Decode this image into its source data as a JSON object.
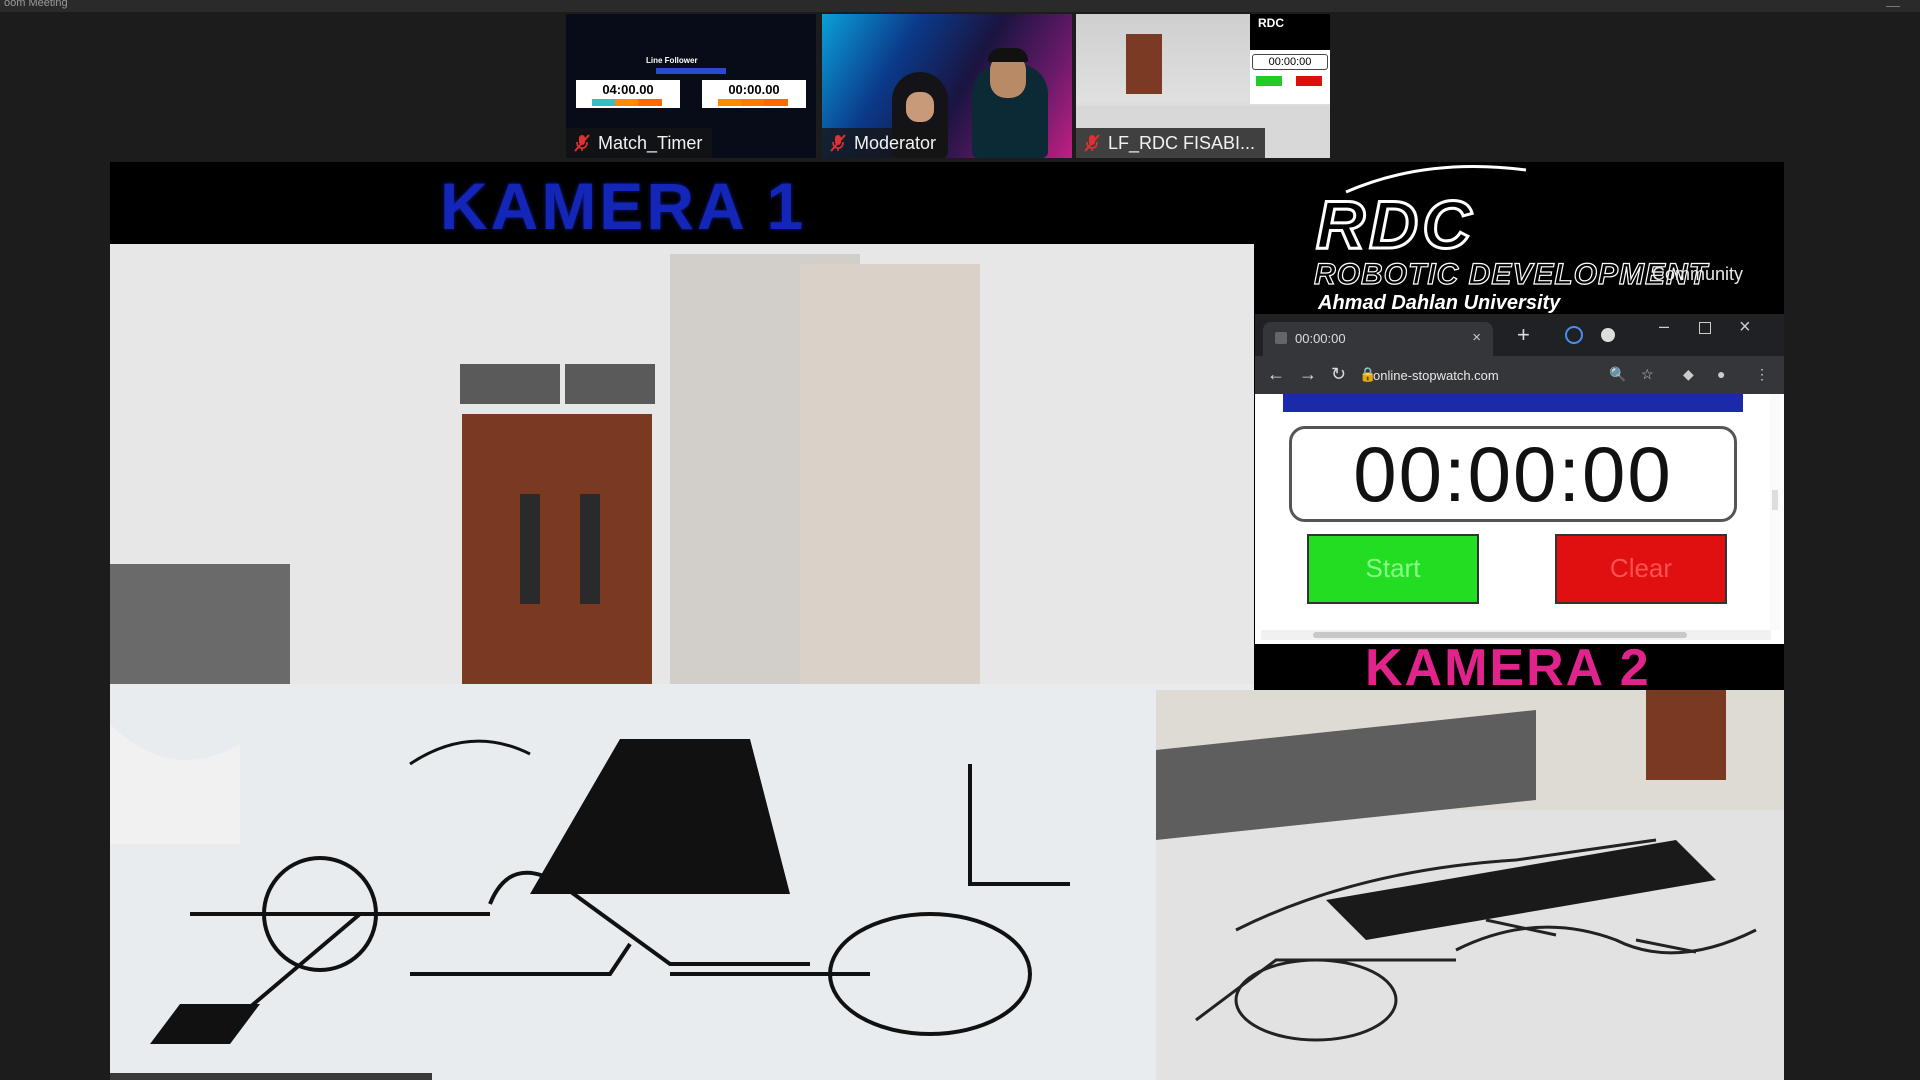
{
  "window": {
    "title": "oom Meeting"
  },
  "participants": [
    {
      "name": "Match_Timer",
      "muted": true
    },
    {
      "name": "Moderator",
      "muted": true
    },
    {
      "name": "LF_RDC FISABI...",
      "muted": true,
      "active_speaker": true
    }
  ],
  "match_timer_thumb": {
    "heading": "Line Follower",
    "timer_left": "04:00.00",
    "timer_right": "00:00.00"
  },
  "rdc_thumb": {
    "logo": "RDC",
    "timer": "00:00:00"
  },
  "stage": {
    "camera1_label": "KAMERA 1",
    "camera2_label": "KAMERA 2"
  },
  "logo": {
    "abbr": "RDC",
    "line1": "ROBOTIC DEVELOPMENT",
    "line1_suffix": "Community",
    "line2": "Ahmad Dahlan University"
  },
  "browser": {
    "tab_title": "00:00:00",
    "url": "online-stopwatch.com",
    "stopwatch": {
      "display": "00:00:00",
      "start_label": "Start",
      "clear_label": "Clear"
    }
  },
  "colors": {
    "camera1_label": "#1426b8",
    "camera2_label": "#e0248c",
    "start_button": "#22dd22",
    "clear_button": "#e01010",
    "active_outline": "#9fd24a"
  }
}
